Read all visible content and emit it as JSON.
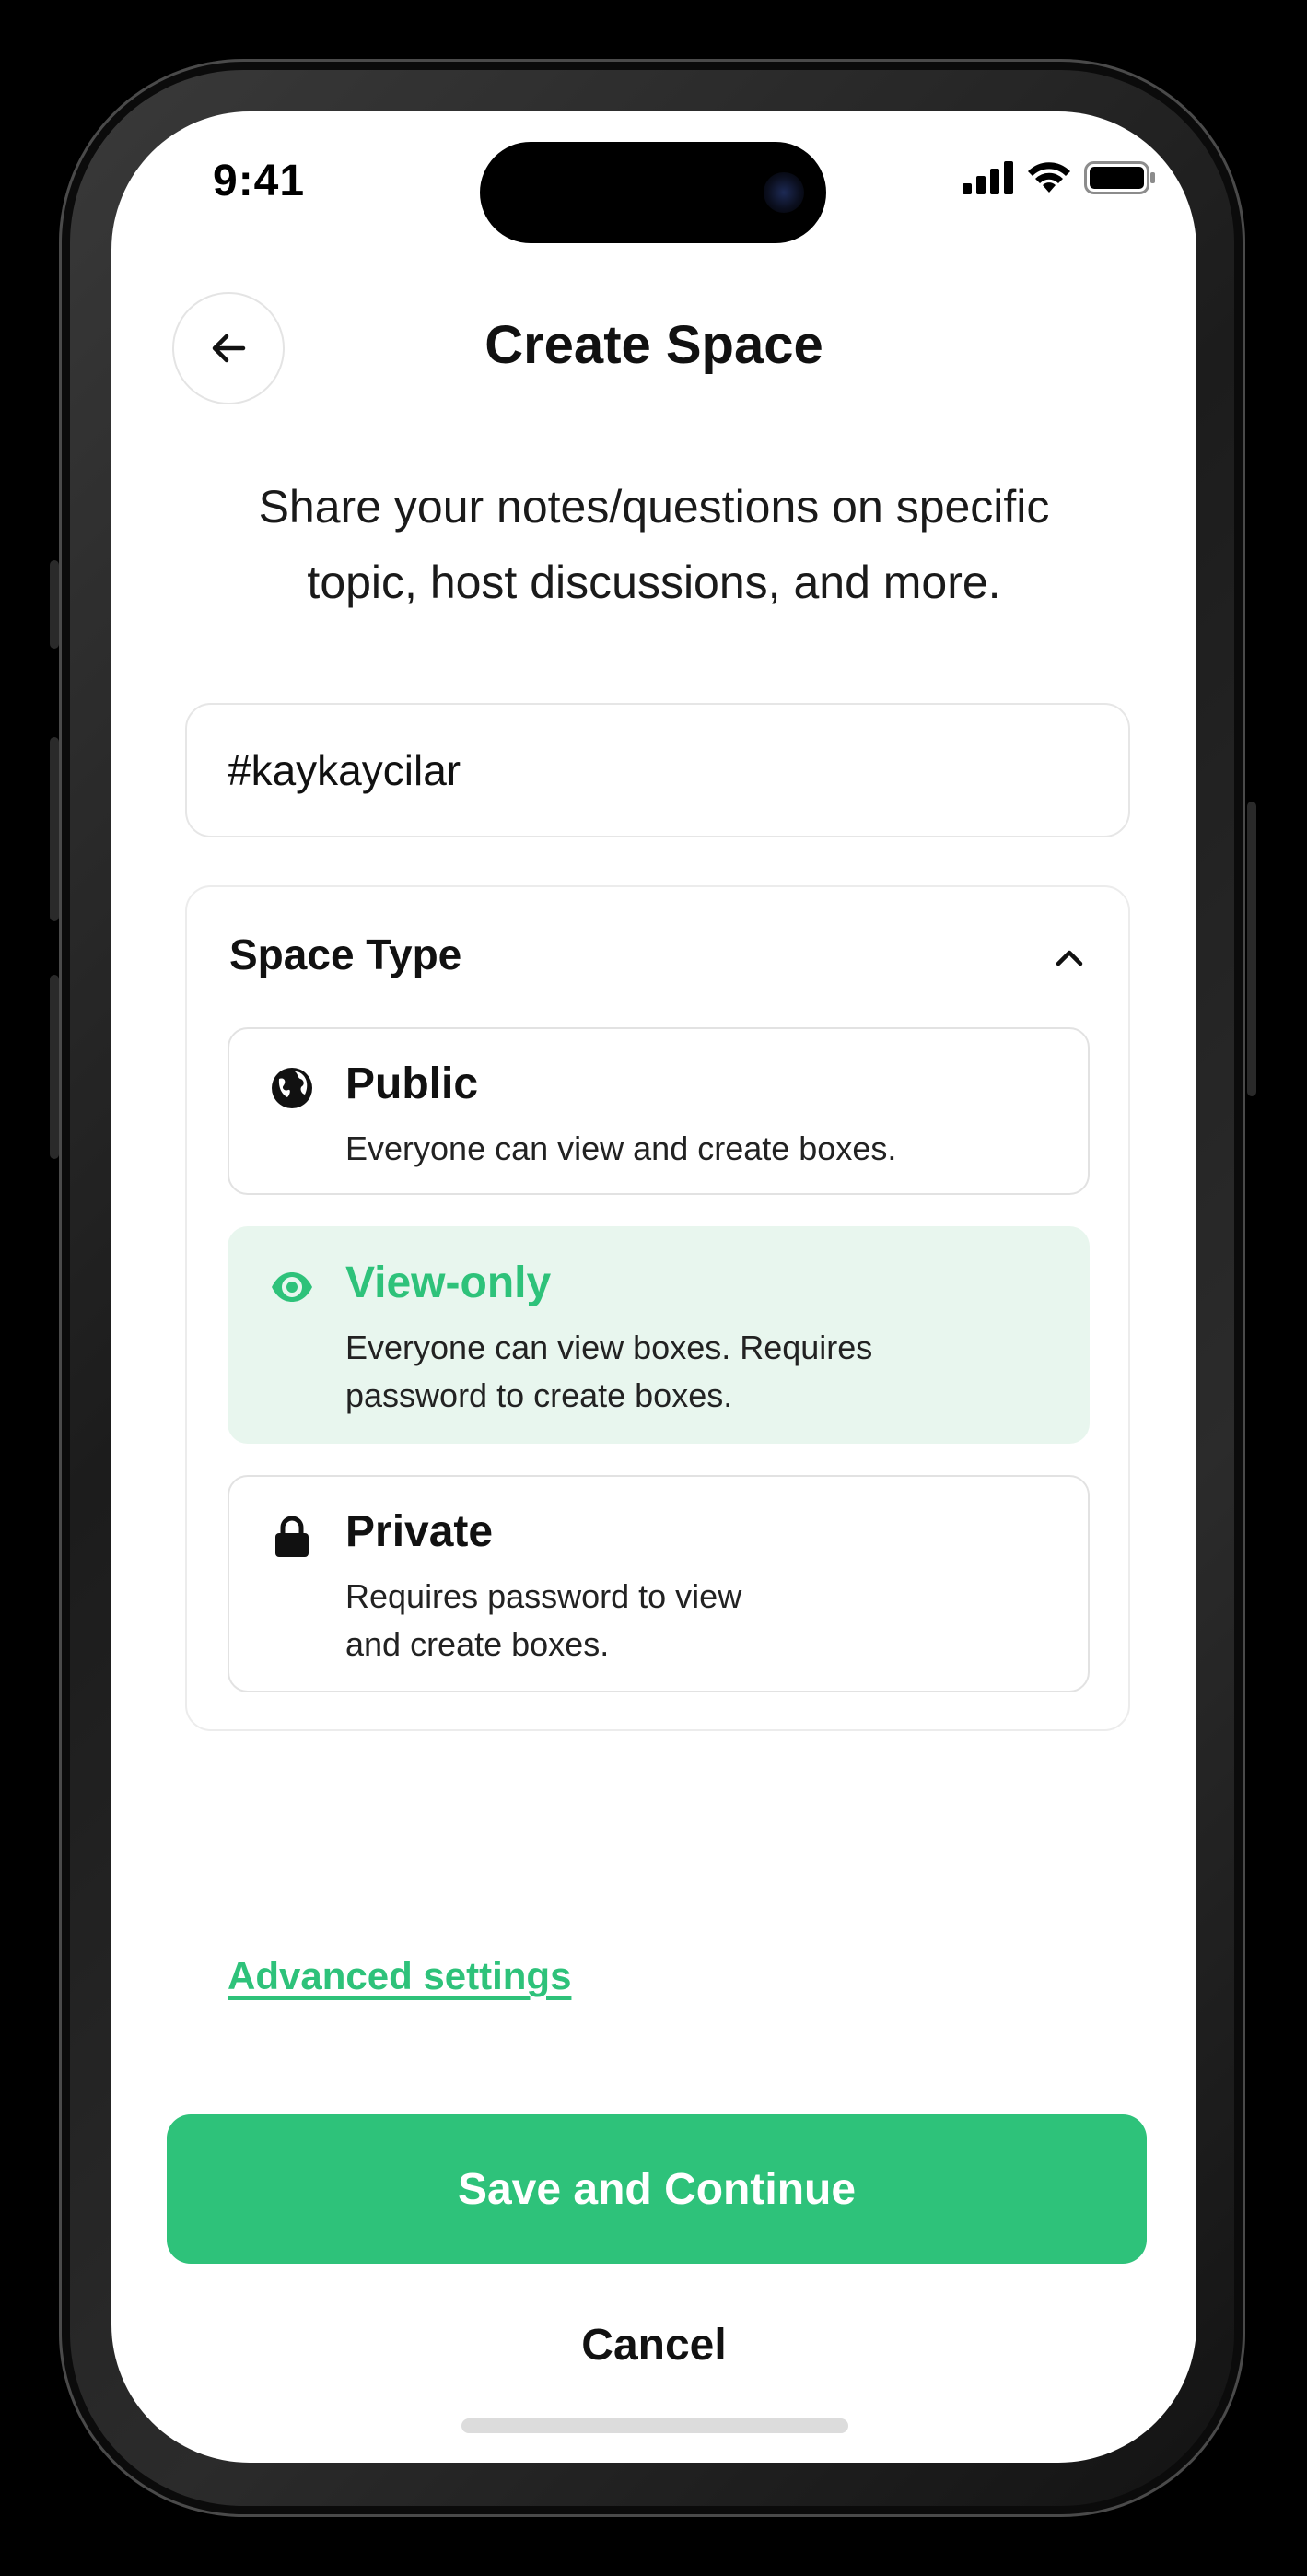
{
  "status_bar": {
    "time": "9:41"
  },
  "header": {
    "title": "Create Space",
    "back_icon": "arrow-left-icon"
  },
  "subtitle": "Share your notes/questions on specific topic, host discussions, and more.",
  "space_name": {
    "value": "#kaykaycilar"
  },
  "space_type": {
    "label": "Space Type",
    "expanded": true,
    "selected": "View-only",
    "options": [
      {
        "icon": "globe-icon",
        "title": "Public",
        "description": "Everyone can view and create boxes."
      },
      {
        "icon": "eye-icon",
        "title": "View-only",
        "description": "Everyone can view boxes. Requires\npassword to create boxes."
      },
      {
        "icon": "lock-icon",
        "title": "Private",
        "description": "Requires password to view\nand create boxes."
      }
    ]
  },
  "advanced_settings": "Advanced settings",
  "actions": {
    "save_label": "Save and Continue",
    "cancel_label": "Cancel"
  },
  "colors": {
    "accent": "#2ec27a",
    "selected_bg": "#e8f6ee",
    "text": "#111111"
  }
}
